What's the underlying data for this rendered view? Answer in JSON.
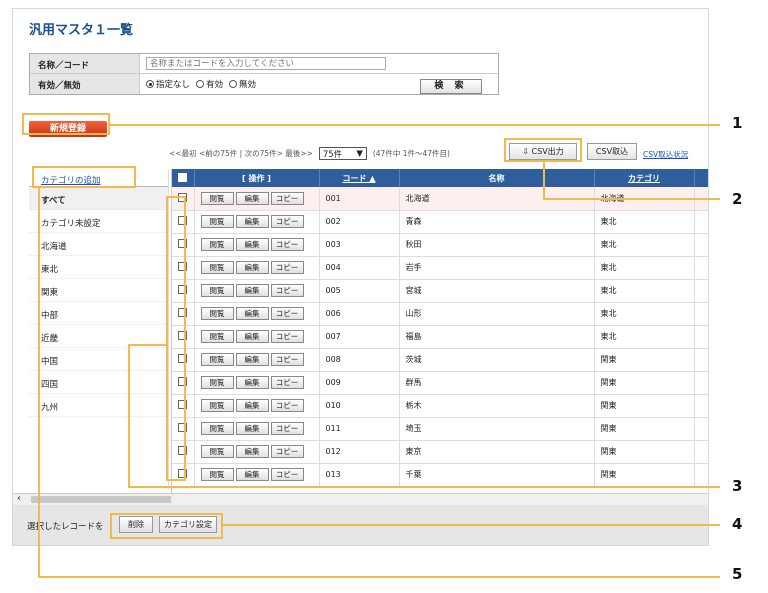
{
  "title": "汎用マスタ１一覧",
  "filter": {
    "name_label": "名称／コード",
    "name_placeholder": "名称またはコードを入力してください",
    "status_label": "有効／無効",
    "options": [
      "指定なし",
      "有効",
      "無効"
    ],
    "search_label": "検 索"
  },
  "new_button": "新規登録",
  "pager": {
    "text": "<<最初 <前の75件 | 次の75件> 最後>>",
    "per_page": "75件",
    "count": "(47件中 1件〜47件目)",
    "csv_export": "⇩ CSV出力",
    "csv_import": "CSV取込",
    "csv_status": "CSV取込状況"
  },
  "sidebar": {
    "add_link": "カテゴリの追加",
    "items": [
      "すべて",
      "カテゴリ未設定",
      "北海道",
      "東北",
      "関東",
      "中部",
      "近畿",
      "中国",
      "四国",
      "九州"
    ]
  },
  "table": {
    "headers": [
      "",
      "[ 操作 ]",
      "コード ▲",
      "名称",
      "カテゴリ",
      ""
    ],
    "actions": [
      "閲覧",
      "編集",
      "コピー"
    ],
    "rows": [
      {
        "code": "001",
        "name": "北海道",
        "cat": "北海道"
      },
      {
        "code": "002",
        "name": "青森",
        "cat": "東北"
      },
      {
        "code": "003",
        "name": "秋田",
        "cat": "東北"
      },
      {
        "code": "004",
        "name": "岩手",
        "cat": "東北"
      },
      {
        "code": "005",
        "name": "宮城",
        "cat": "東北"
      },
      {
        "code": "006",
        "name": "山形",
        "cat": "東北"
      },
      {
        "code": "007",
        "name": "福島",
        "cat": "東北"
      },
      {
        "code": "008",
        "name": "茨城",
        "cat": "関東"
      },
      {
        "code": "009",
        "name": "群馬",
        "cat": "関東"
      },
      {
        "code": "010",
        "name": "栃木",
        "cat": "関東"
      },
      {
        "code": "011",
        "name": "埼玉",
        "cat": "関東"
      },
      {
        "code": "012",
        "name": "東京",
        "cat": "関東"
      },
      {
        "code": "013",
        "name": "千葉",
        "cat": "関東"
      }
    ]
  },
  "bottom": {
    "text": "選択したレコードを",
    "delete": "削除",
    "category_set": "カテゴリ設定"
  },
  "callouts": [
    "1",
    "2",
    "3",
    "4",
    "5"
  ],
  "colors": {
    "accent": "#f2b94c",
    "header": "#2e5f9c",
    "new_button": "#d8401c",
    "link": "#1a4fc4"
  }
}
